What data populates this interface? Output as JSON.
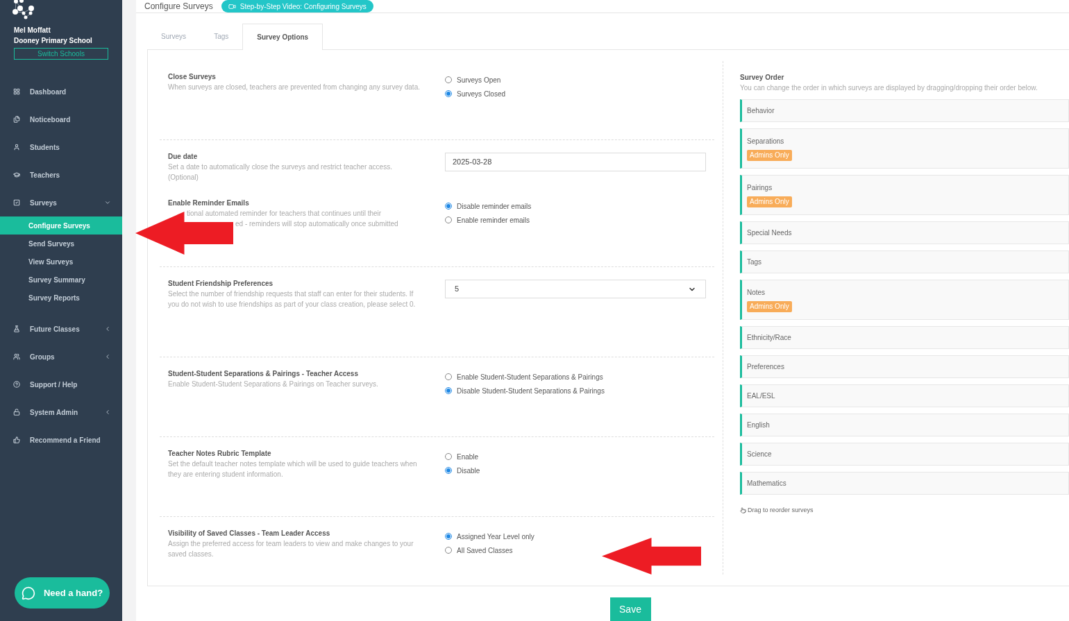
{
  "header": {
    "title": "Configure Surveys",
    "video_button": "Step-by-Step Video: Configuring Surveys"
  },
  "sidebar": {
    "user": "Mel Moffatt",
    "school": "Dooney Primary School",
    "switch_button": "Switch Schools",
    "items": [
      {
        "label": "Dashboard",
        "selected": false
      },
      {
        "label": "Noticeboard",
        "selected": false
      },
      {
        "label": "Students",
        "selected": false
      },
      {
        "label": "Teachers",
        "selected": false
      },
      {
        "label": "Surveys",
        "expanded": true,
        "selected": false,
        "children": [
          {
            "label": "Configure Surveys",
            "selected": true
          },
          {
            "label": "Send Surveys",
            "selected": false
          },
          {
            "label": "View Surveys",
            "selected": false
          },
          {
            "label": "Survey Summary",
            "selected": false
          },
          {
            "label": "Survey Reports",
            "selected": false
          }
        ]
      },
      {
        "label": "Future Classes",
        "expanded": false,
        "selected": false
      },
      {
        "label": "Groups",
        "expanded": false,
        "selected": false
      },
      {
        "label": "Support / Help",
        "selected": false
      },
      {
        "label": "System Admin",
        "expanded": false,
        "selected": false
      },
      {
        "label": "Recommend a Friend",
        "selected": false
      }
    ]
  },
  "help_button": "Need a hand?",
  "tabs": [
    {
      "label": "Surveys",
      "selected": false
    },
    {
      "label": "Tags",
      "selected": false
    },
    {
      "label": "Survey Options",
      "selected": true
    }
  ],
  "sections": [
    {
      "items": [
        {
          "title": "Close Surveys",
          "description": [
            "When surveys are closed, teachers are prevented from changing any survey data."
          ],
          "control": {
            "kind": "radio",
            "options": [
              {
                "label": "Surveys Open",
                "selected": false
              },
              {
                "label": "Surveys Closed",
                "selected": true
              }
            ]
          }
        }
      ]
    },
    {
      "items": [
        {
          "title": "Due date",
          "description": [
            "Set a date to automatically close the surveys and restrict teacher access. (Optional)"
          ],
          "control": {
            "kind": "date",
            "value": "2025-03-28"
          }
        },
        {
          "title": "Enable Reminder Emails",
          "description": [
            "tional automated reminder for teachers that continues until their",
            "ed - reminders will stop automatically once submitted"
          ],
          "control": {
            "kind": "radio",
            "options": [
              {
                "label": "Disable reminder emails",
                "selected": true
              },
              {
                "label": "Enable reminder emails",
                "selected": false
              }
            ]
          }
        }
      ]
    },
    {
      "items": [
        {
          "title": "Student Friendship Preferences",
          "description": [
            "Select the number of friendship requests that staff can enter for their students. If you do not wish to use friendships as part of your class creation, please select 0."
          ],
          "control": {
            "kind": "select",
            "value": "5"
          }
        }
      ]
    },
    {
      "items": [
        {
          "title": "Student-Student Separations & Pairings - Teacher Access",
          "description": [
            "Enable Student-Student Separations & Pairings on Teacher surveys."
          ],
          "control": {
            "kind": "radio",
            "options": [
              {
                "label": "Enable Student-Student Separations & Pairings",
                "selected": false
              },
              {
                "label": "Disable Student-Student Separations & Pairings",
                "selected": true
              }
            ]
          }
        }
      ]
    },
    {
      "items": [
        {
          "title": "Teacher Notes Rubric Template",
          "description": [
            "Set the default teacher notes template which will be used to guide teachers when they are entering student information."
          ],
          "control": {
            "kind": "radio",
            "options": [
              {
                "label": "Enable",
                "selected": false
              },
              {
                "label": "Disable",
                "selected": true
              }
            ]
          }
        }
      ]
    },
    {
      "items": [
        {
          "title": "Visibility of Saved Classes - Team Leader Access",
          "description": [
            "Assign the preferred access for team leaders to view and make changes to your saved classes."
          ],
          "control": {
            "kind": "radio",
            "options": [
              {
                "label": "Assigned Year Level only",
                "selected": true
              },
              {
                "label": "All Saved Classes",
                "selected": false
              }
            ]
          }
        }
      ]
    }
  ],
  "survey_order": {
    "title": "Survey Order",
    "description": "You can change the order in which surveys are displayed by dragging/dropping their order below.",
    "items": [
      {
        "name": "Behavior"
      },
      {
        "name": "Separations",
        "badge": "Admins Only"
      },
      {
        "name": "Pairings",
        "badge": "Admins Only"
      },
      {
        "name": "Special Needs"
      },
      {
        "name": "Tags"
      },
      {
        "name": "Notes",
        "badge": "Admins Only"
      },
      {
        "name": "Ethnicity/Race"
      },
      {
        "name": "Preferences"
      },
      {
        "name": "EAL/ESL"
      },
      {
        "name": "English"
      },
      {
        "name": "Science"
      },
      {
        "name": "Mathematics"
      }
    ],
    "hint": "Drag to reorder surveys"
  },
  "save_button": "Save"
}
